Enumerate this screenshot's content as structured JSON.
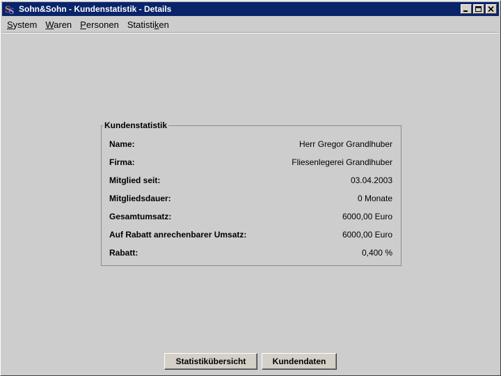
{
  "window": {
    "title": "Sohn&Sohn - Kundenstatistik - Details",
    "app_icon": "sohn-logo-icon",
    "controls": [
      "minimize-icon",
      "maximize-icon",
      "close-icon"
    ]
  },
  "menu": [
    {
      "label": "System",
      "mnemonic": "S"
    },
    {
      "label": "Waren",
      "mnemonic": "W"
    },
    {
      "label": "Personen",
      "mnemonic": "P"
    },
    {
      "label": "Statistiken",
      "mnemonic": "k"
    }
  ],
  "panel": {
    "title": "Kundenstatistik",
    "rows": [
      {
        "label": "Name:",
        "value": "Herr Gregor Grandlhuber"
      },
      {
        "label": "Firma:",
        "value": "Fliesenlegerei Grandlhuber"
      },
      {
        "label": "Mitglied seit:",
        "value": "03.04.2003"
      },
      {
        "label": "Mitgliedsdauer:",
        "value": "0 Monate"
      },
      {
        "label": "Gesamtumsatz:",
        "value": "6000,00 Euro"
      },
      {
        "label": "Auf Rabatt anrechenbarer Umsatz:",
        "value": "6000,00 Euro"
      },
      {
        "label": "Rabatt:",
        "value": "0,400 %"
      }
    ]
  },
  "buttons": {
    "statistics_overview": "Statistikübersicht",
    "customer_data": "Kundendaten"
  },
  "colors": {
    "titlebar": "#0a246a",
    "background": "#cdcdcd"
  }
}
